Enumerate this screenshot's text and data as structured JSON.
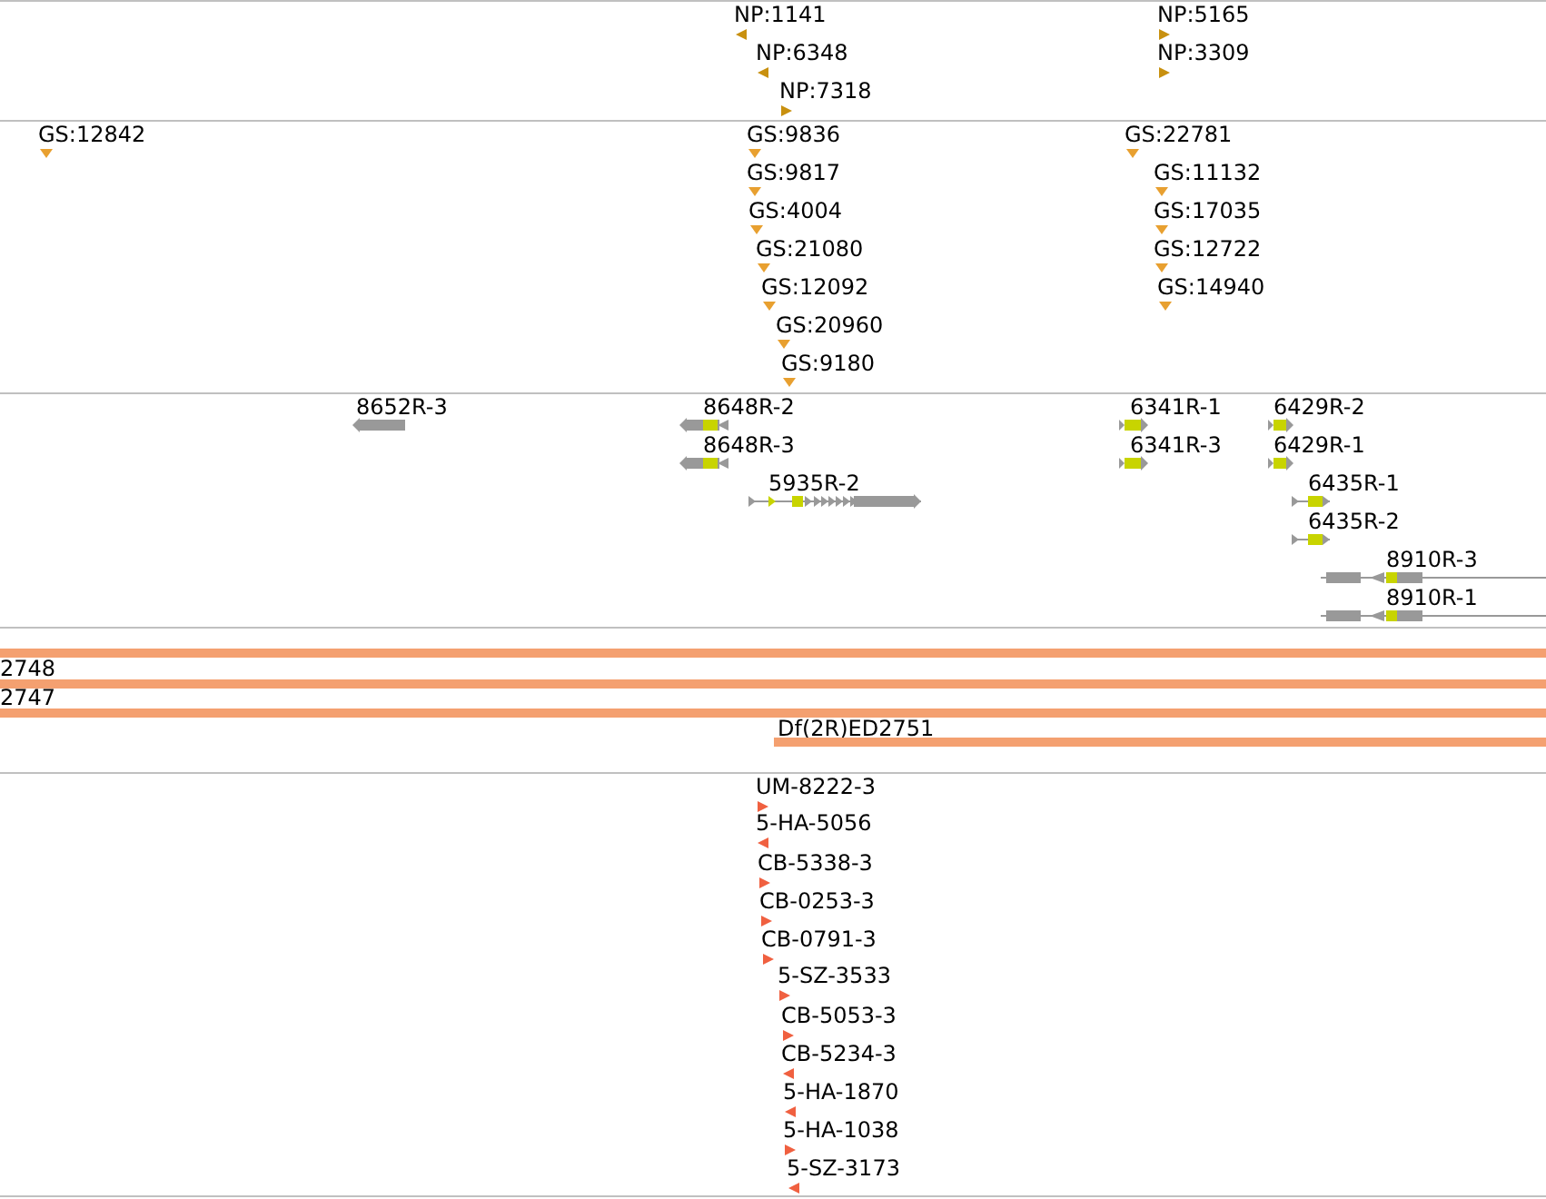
{
  "tracks": [
    {
      "kind": "marker",
      "features": [
        {
          "label": "NP:1141",
          "reverse": true
        },
        {
          "label": "NP:6348",
          "reverse": true
        },
        {
          "label": "NP:7318",
          "reverse": false
        },
        {
          "label": "NP:5165",
          "reverse": false
        },
        {
          "label": "NP:3309",
          "reverse": false
        }
      ]
    },
    {
      "kind": "marker",
      "features": [
        {
          "label": "GS:12842"
        },
        {
          "label": "GS:9836"
        },
        {
          "label": "GS:9817"
        },
        {
          "label": "GS:4004"
        },
        {
          "label": "GS:21080"
        },
        {
          "label": "GS:12092"
        },
        {
          "label": "GS:20960"
        },
        {
          "label": "GS:9180"
        },
        {
          "label": "GS:22781"
        },
        {
          "label": "GS:11132"
        },
        {
          "label": "GS:17035"
        },
        {
          "label": "GS:12722"
        },
        {
          "label": "GS:14940"
        }
      ]
    },
    {
      "kind": "gene",
      "features": [
        {
          "label": "8652R-3",
          "reverse": true
        },
        {
          "label": "8648R-2",
          "reverse": true
        },
        {
          "label": "8648R-3",
          "reverse": true
        },
        {
          "label": "5935R-2",
          "reverse": false
        },
        {
          "label": "6341R-1",
          "reverse": false
        },
        {
          "label": "6341R-3",
          "reverse": false
        },
        {
          "label": "6429R-2",
          "reverse": false
        },
        {
          "label": "6429R-1",
          "reverse": false
        },
        {
          "label": "6435R-1",
          "reverse": false
        },
        {
          "label": "6435R-2",
          "reverse": false
        },
        {
          "label": "8910R-3",
          "reverse": true
        },
        {
          "label": "8910R-1",
          "reverse": true
        }
      ]
    },
    {
      "kind": "span",
      "unlabeled_bar": true,
      "features": [
        {
          "label": "2748"
        },
        {
          "label": "2747"
        },
        {
          "label": "Df(2R)ED2751"
        }
      ]
    },
    {
      "kind": "marker",
      "features": [
        {
          "label": "UM-8222-3",
          "reverse": false
        },
        {
          "label": "5-HA-5056",
          "reverse": true
        },
        {
          "label": "CB-5338-3",
          "reverse": false
        },
        {
          "label": "CB-0253-3",
          "reverse": false
        },
        {
          "label": "CB-0791-3",
          "reverse": false
        },
        {
          "label": "5-SZ-3533",
          "reverse": false
        },
        {
          "label": "CB-5053-3",
          "reverse": false
        },
        {
          "label": "CB-5234-3",
          "reverse": true
        },
        {
          "label": "5-HA-1870",
          "reverse": true
        },
        {
          "label": "5-HA-1038",
          "reverse": false
        },
        {
          "label": "5-SZ-3173",
          "reverse": true
        }
      ]
    }
  ]
}
